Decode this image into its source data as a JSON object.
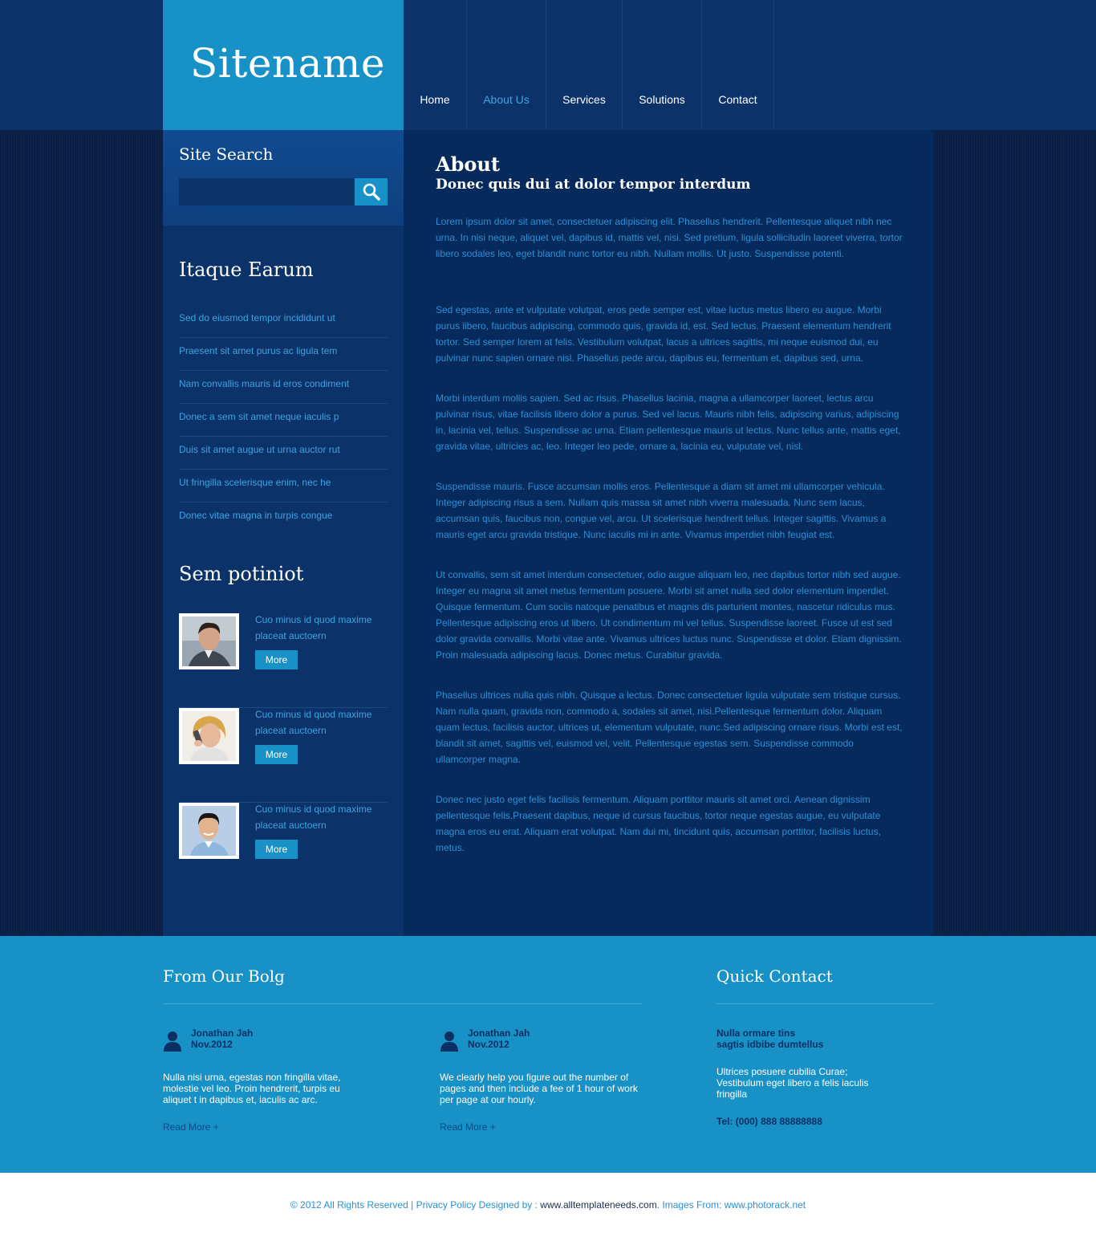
{
  "site": {
    "name": "Sitename"
  },
  "nav": [
    {
      "label": "Home",
      "active": false
    },
    {
      "label": "About Us",
      "active": true
    },
    {
      "label": "Services",
      "active": false
    },
    {
      "label": "Solutions",
      "active": false
    },
    {
      "label": "Contact",
      "active": false
    }
  ],
  "search": {
    "title": "Site Search",
    "placeholder": "",
    "icon": "search-icon"
  },
  "sidebar": {
    "list_title": "Itaque Earum",
    "list": [
      "Sed do eiusmod tempor incididunt ut",
      "Praesent sit amet purus ac ligula tem",
      "Nam convallis mauris id eros condiment",
      "Donec a sem sit amet neque iaculis p",
      "Duis sit amet augue ut urna auctor rut",
      "Ut fringilla scelerisque enim, nec he",
      "Donec vitae magna in turpis congue"
    ],
    "people_title": "Sem potiniot",
    "people": [
      {
        "text": "Cuo minus id quod maxime placeat auctoern",
        "button": "More"
      },
      {
        "text": "Cuo minus id quod maxime placeat auctoern",
        "button": "More"
      },
      {
        "text": "Cuo minus id quod maxime placeat auctoern",
        "button": "More"
      }
    ]
  },
  "main": {
    "title": "About",
    "subtitle": "Donec quis dui at dolor tempor interdum",
    "paragraphs": [
      "Lorem ipsum dolor sit amet, consectetuer adipiscing elit. Phasellus hendrerit. Pellentesque aliquet nibh nec urna. In nisi neque, aliquet vel, dapibus id, mattis vel, nisi. Sed pretium, ligula sollicitudin laoreet viverra, tortor libero sodales leo, eget blandit nunc tortor eu nibh. Nullam mollis. Ut justo. Suspendisse potenti.",
      "Sed egestas, ante et vulputate volutpat, eros pede semper est, vitae luctus metus libero eu augue. Morbi purus libero, faucibus adipiscing, commodo quis, gravida id, est. Sed lectus. Praesent elementum hendrerit tortor. Sed semper lorem at felis. Vestibulum volutpat, lacus a ultrices sagittis, mi neque euismod dui, eu pulvinar nunc sapien ornare nisl. Phasellus pede arcu, dapibus eu, fermentum et, dapibus sed, urna.",
      "Morbi interdum mollis sapien. Sed ac risus. Phasellus lacinia, magna a ullamcorper laoreet, lectus arcu pulvinar risus, vitae facilisis libero dolor a purus. Sed vel lacus. Mauris nibh felis, adipiscing varius, adipiscing in, lacinia vel, tellus. Suspendisse ac urna. Etiam pellentesque mauris ut lectus. Nunc tellus ante, mattis eget, gravida vitae, ultricies ac, leo. Integer leo pede, ornare a, lacinia eu, vulputate vel, nisl.",
      "Suspendisse mauris. Fusce accumsan mollis eros. Pellentesque a diam sit amet mi ullamcorper vehicula. Integer adipiscing risus a sem. Nullam quis massa sit amet nibh viverra malesuada. Nunc sem lacus, accumsan quis, faucibus non, congue vel, arcu. Ut scelerisque hendrerit tellus. Integer sagittis. Vivamus a mauris eget arcu gravida tristique. Nunc iaculis mi in ante. Vivamus imperdiet nibh feugiat est.",
      "Ut convallis, sem sit amet interdum consectetuer, odio augue aliquam leo, nec dapibus tortor nibh sed augue. Integer eu magna sit amet metus fermentum posuere. Morbi sit amet nulla sed dolor elementum imperdiet. Quisque fermentum. Cum sociis natoque penatibus et magnis dis parturient montes, nascetur ridiculus mus. Pellentesque adipiscing eros ut libero. Ut condimentum mi vel tellus. Suspendisse laoreet. Fusce ut est sed dolor gravida convallis. Morbi vitae ante. Vivamus ultrices luctus nunc. Suspendisse et dolor. Etiam dignissim. Proin malesuada adipiscing lacus. Donec metus. Curabitur gravida.",
      "Phasellus ultrices nulla quis nibh. Quisque a lectus. Donec consectetuer ligula vulputate sem tristique cursus. Nam nulla quam, gravida non, commodo a, sodales sit amet, nisi.Pellentesque fermentum dolor. Aliquam quam lectus, facilisis auctor, ultrices ut, elementum vulputate, nunc.Sed adipiscing ornare risus. Morbi est est, blandit sit amet, sagittis vel, euismod vel, velit. Pellentesque egestas sem. Suspendisse commodo ullamcorper magna.",
      "Donec nec justo eget felis facilisis fermentum. Aliquam porttitor mauris sit amet orci. Aenean dignissim pellentesque felis.Praesent dapibus, neque id cursus faucibus, tortor neque egestas augue, eu vulputate magna eros eu erat. Aliquam erat volutpat. Nam dui mi, tincidunt quis, accumsan porttitor, facilisis luctus, metus."
    ]
  },
  "footer": {
    "blog_title": "From Our Bolg",
    "posts": [
      {
        "author": "Jonathan Jah",
        "date": "Nov.2012",
        "text": "Nulla nisi urna, egestas non fringilla vitae, molestie vel leo. Proin hendrerit, turpis eu aliquet t in dapibus et, iaculis ac arc.",
        "more": "Read More +"
      },
      {
        "author": "Jonathan Jah",
        "date": "Nov.2012",
        "text": "We clearly help you figure out the number of pages and then include a fee of 1 hour of work per page at our hourly.",
        "more": "Read More +"
      }
    ],
    "contact_title": "Quick Contact",
    "contact": {
      "line1": "Nulla ormare tins",
      "line2": "sagtis idbibe dumtellus",
      "para": "Ultrices posuere cubilia Curae; Vestibulum eget libero a felis iaculis fringilla",
      "tel": "Tel: (000) 888 88888888"
    }
  },
  "copyright": {
    "prefix": "© 2012 All Rights Reserved | Privacy Policy Designed by : ",
    "designer": "www.alltemplateneeds.com",
    "images_prefix": ". Images From: ",
    "images": "www.photorack.net"
  },
  "colors": {
    "accent": "#1791c6",
    "header": "#0b336a",
    "content": "#072a5c",
    "link": "#3ea3df"
  }
}
